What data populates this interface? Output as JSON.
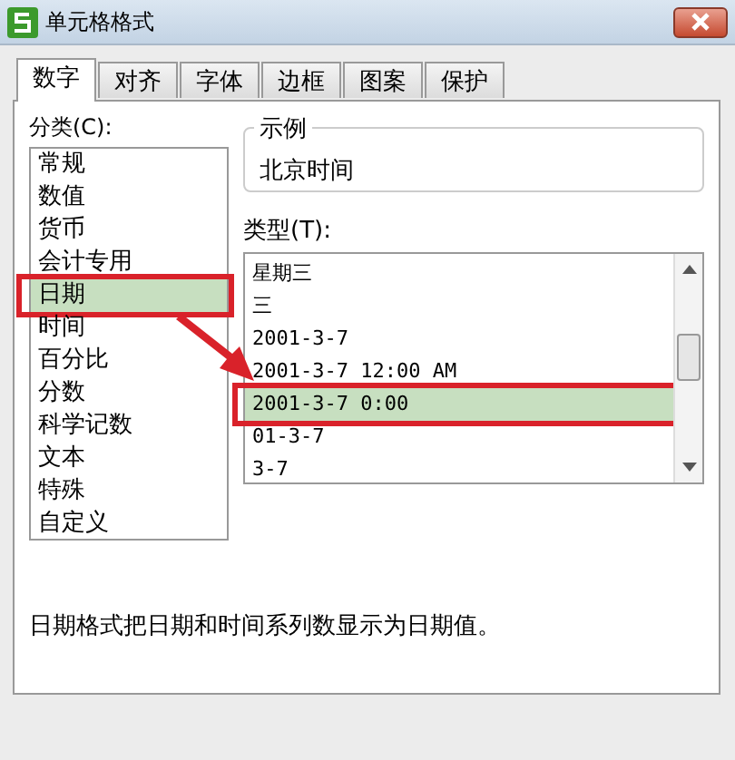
{
  "window": {
    "title": "单元格格式"
  },
  "tabs": [
    {
      "label": "数字",
      "selected": true
    },
    {
      "label": "对齐",
      "selected": false
    },
    {
      "label": "字体",
      "selected": false
    },
    {
      "label": "边框",
      "selected": false
    },
    {
      "label": "图案",
      "selected": false
    },
    {
      "label": "保护",
      "selected": false
    }
  ],
  "category": {
    "label": "分类(C):",
    "items": [
      {
        "label": "常规",
        "selected": false
      },
      {
        "label": "数值",
        "selected": false
      },
      {
        "label": "货币",
        "selected": false
      },
      {
        "label": "会计专用",
        "selected": false
      },
      {
        "label": "日期",
        "selected": true
      },
      {
        "label": "时间",
        "selected": false
      },
      {
        "label": "百分比",
        "selected": false
      },
      {
        "label": "分数",
        "selected": false
      },
      {
        "label": "科学记数",
        "selected": false
      },
      {
        "label": "文本",
        "selected": false
      },
      {
        "label": "特殊",
        "selected": false
      },
      {
        "label": "自定义",
        "selected": false
      }
    ]
  },
  "sample": {
    "legend": "示例",
    "value": "北京时间"
  },
  "type": {
    "label": "类型(T):",
    "items": [
      {
        "label": "星期三",
        "selected": false
      },
      {
        "label": "三",
        "selected": false
      },
      {
        "label": "2001-3-7",
        "selected": false
      },
      {
        "label": "2001-3-7 12:00 AM",
        "selected": false
      },
      {
        "label": "2001-3-7 0:00",
        "selected": true
      },
      {
        "label": "01-3-7",
        "selected": false
      },
      {
        "label": "3-7",
        "selected": false
      }
    ]
  },
  "description": "日期格式把日期和时间系列数显示为日期值。"
}
